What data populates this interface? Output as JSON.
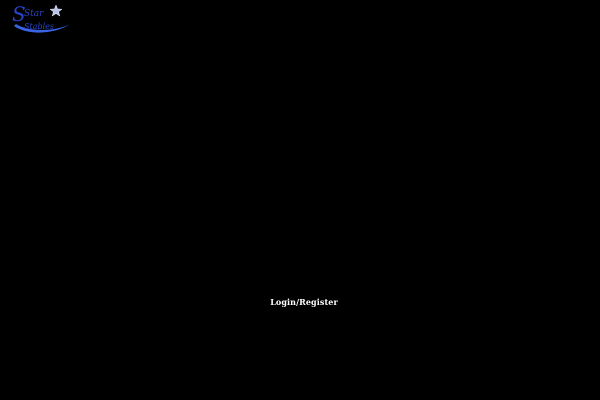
{
  "logo": {
    "name": "star-stables-logo",
    "text_line1": "Star",
    "text_line2": "Stables",
    "color": "#2a44c8",
    "swoosh_color": "#3a64e6",
    "star_color": "#b8c4e8"
  },
  "main": {
    "login_register_label": "Login/Register"
  },
  "colors": {
    "background": "#000000",
    "text": "#ffffff"
  }
}
